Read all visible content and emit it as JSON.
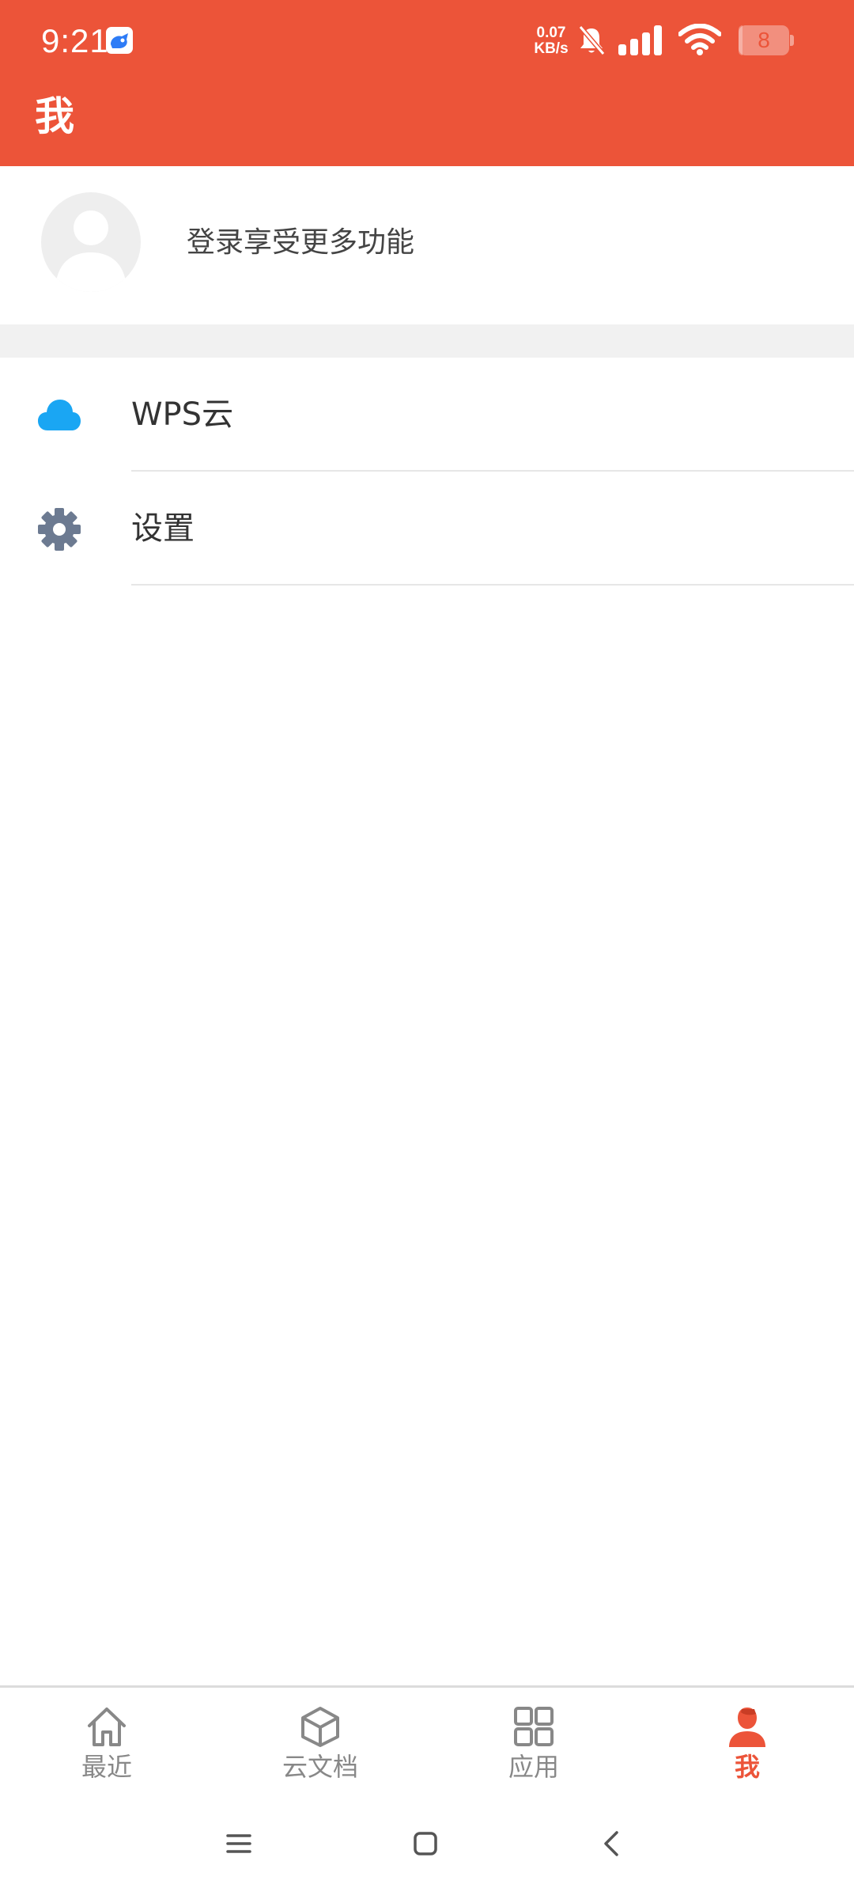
{
  "status_bar": {
    "time": "9:21",
    "net_speed_value": "0.07",
    "net_speed_unit": "KB/s",
    "battery": "8",
    "battery_level": 0.08
  },
  "header": {
    "title": "我"
  },
  "profile": {
    "login_prompt": "登录享受更多功能"
  },
  "menu": {
    "items": [
      {
        "label": "WPS云",
        "icon": "cloud-icon",
        "color": "#1AA6F3"
      },
      {
        "label": "设置",
        "icon": "gear-icon",
        "color": "#6C7A91"
      }
    ]
  },
  "bottom_nav": {
    "items": [
      {
        "label": "最近",
        "icon": "home-icon"
      },
      {
        "label": "云文档",
        "icon": "cube-icon"
      },
      {
        "label": "应用",
        "icon": "grid-icon"
      },
      {
        "label": "我",
        "icon": "user-icon",
        "active": true
      }
    ]
  },
  "colors": {
    "accent": "#EC5439",
    "inactive": "#888888"
  }
}
